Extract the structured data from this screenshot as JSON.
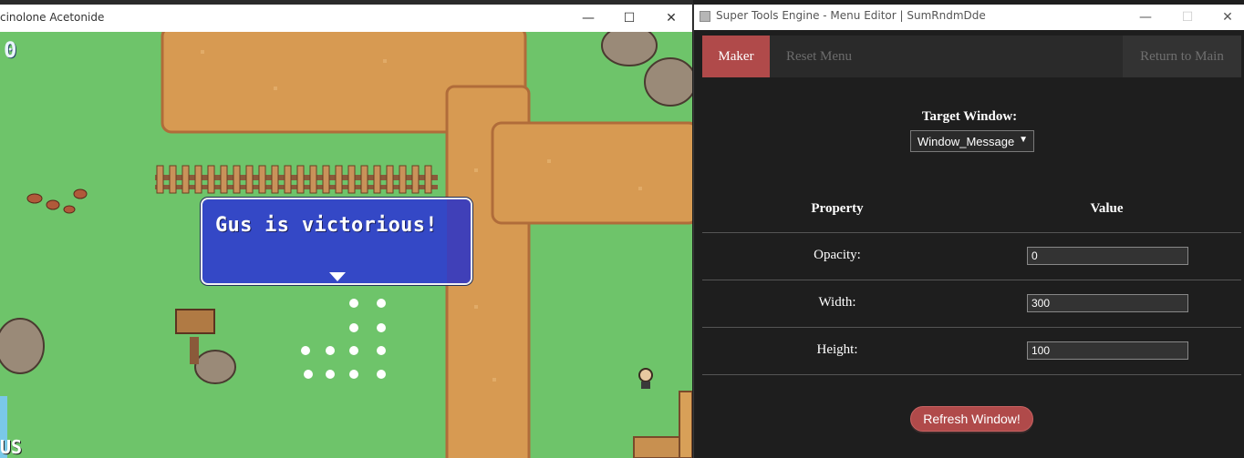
{
  "game_window": {
    "title": "cinolone Acetonide",
    "controls": {
      "minimize": "—",
      "maximize": "☐",
      "close": "✕"
    },
    "message": "Gus is victorious!",
    "hud_top_left": "0",
    "hud_bottom_left": "US"
  },
  "editor_window": {
    "title": "Super Tools Engine  -  Menu Editor  |  SumRndmDde",
    "controls": {
      "minimize": "—",
      "maximize": "☐",
      "close": "✕"
    },
    "nav": {
      "maker": "Maker",
      "reset": "Reset Menu",
      "return": "Return to Main"
    },
    "target_label": "Target Window:",
    "target_value": "Window_Message",
    "table": {
      "header_property": "Property",
      "header_value": "Value",
      "rows": [
        {
          "label": "Opacity:",
          "value": "0"
        },
        {
          "label": "Width:",
          "value": "300"
        },
        {
          "label": "Height:",
          "value": "100"
        }
      ]
    },
    "refresh_label": "Refresh Window!"
  },
  "colors": {
    "accent_red": "#b04a4a",
    "editor_bg": "#1e1e1e",
    "message_blue": "#3448c6",
    "grass": "#6ec46a",
    "dirt": "#d79a52"
  }
}
